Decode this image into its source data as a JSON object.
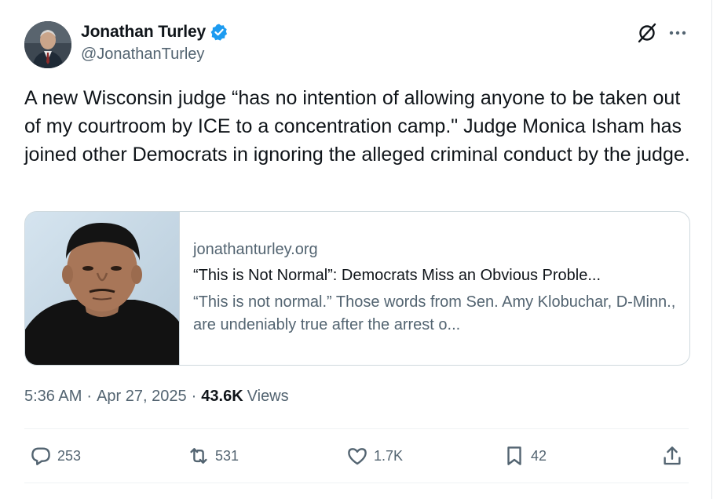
{
  "author": {
    "name": "Jonathan Turley",
    "handle": "@JonathanTurley",
    "verified": true,
    "verified_color": "#1d9bf0"
  },
  "header_icons": [
    "grok-icon",
    "more-icon"
  ],
  "tweet": {
    "text": "A new Wisconsin judge “has no intention of allowing anyone to be taken out of my courtroom by ICE to a concentration camp.\" Judge Monica Isham has joined other Democrats in ignoring the alleged criminal conduct by the judge."
  },
  "link_card": {
    "domain": "jonathanturley.org",
    "title": "“This is Not Normal”: Democrats Miss an Obvious Proble...",
    "description": "“This is not normal.” Those words from Sen. Amy Klobuchar, D-Minn., are undeniably true after the arrest o..."
  },
  "meta": {
    "time": "5:36 AM",
    "separator": "·",
    "date": "Apr 27, 2025",
    "views_count": "43.6K",
    "views_label": "Views"
  },
  "actions": {
    "replies": "253",
    "reposts": "531",
    "likes": "1.7K",
    "bookmarks": "42"
  },
  "colors": {
    "text": "#0f1419",
    "secondary": "#536471",
    "border": "#cfd9de",
    "accent": "#1d9bf0"
  }
}
